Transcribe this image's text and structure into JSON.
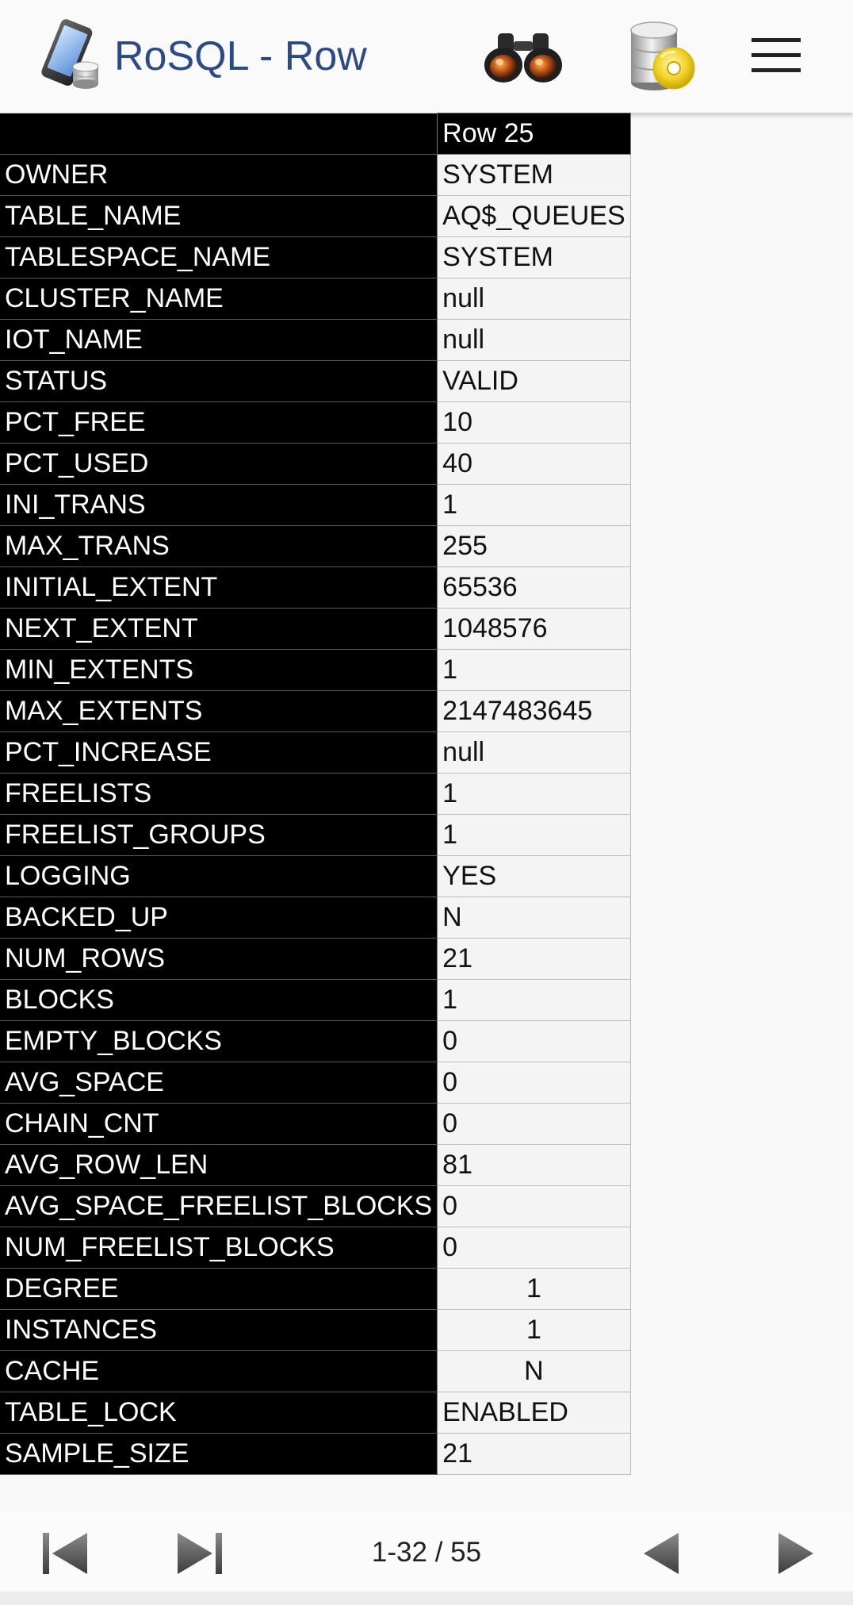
{
  "header": {
    "title": "RoSQL - Row",
    "icons": [
      "app-logo-icon",
      "binoculars-icon",
      "database-disc-icon",
      "hamburger-menu-icon"
    ]
  },
  "table": {
    "column_header": "Row 25",
    "rows": [
      {
        "key": "OWNER",
        "value": "SYSTEM",
        "align": "left"
      },
      {
        "key": "TABLE_NAME",
        "value": "AQ$_QUEUES",
        "align": "left"
      },
      {
        "key": "TABLESPACE_NAME",
        "value": "SYSTEM",
        "align": "left"
      },
      {
        "key": "CLUSTER_NAME",
        "value": "null",
        "align": "left"
      },
      {
        "key": "IOT_NAME",
        "value": "null",
        "align": "left"
      },
      {
        "key": "STATUS",
        "value": "VALID",
        "align": "left"
      },
      {
        "key": "PCT_FREE",
        "value": "10",
        "align": "left"
      },
      {
        "key": "PCT_USED",
        "value": "40",
        "align": "left"
      },
      {
        "key": "INI_TRANS",
        "value": "1",
        "align": "left"
      },
      {
        "key": "MAX_TRANS",
        "value": "255",
        "align": "left"
      },
      {
        "key": "INITIAL_EXTENT",
        "value": "65536",
        "align": "left"
      },
      {
        "key": "NEXT_EXTENT",
        "value": "1048576",
        "align": "left"
      },
      {
        "key": "MIN_EXTENTS",
        "value": "1",
        "align": "left"
      },
      {
        "key": "MAX_EXTENTS",
        "value": "2147483645",
        "align": "left"
      },
      {
        "key": "PCT_INCREASE",
        "value": "null",
        "align": "left"
      },
      {
        "key": "FREELISTS",
        "value": "1",
        "align": "left"
      },
      {
        "key": "FREELIST_GROUPS",
        "value": "1",
        "align": "left"
      },
      {
        "key": "LOGGING",
        "value": "YES",
        "align": "left"
      },
      {
        "key": "BACKED_UP",
        "value": "N",
        "align": "left"
      },
      {
        "key": "NUM_ROWS",
        "value": "21",
        "align": "left"
      },
      {
        "key": "BLOCKS",
        "value": "1",
        "align": "left"
      },
      {
        "key": "EMPTY_BLOCKS",
        "value": "0",
        "align": "left"
      },
      {
        "key": "AVG_SPACE",
        "value": "0",
        "align": "left"
      },
      {
        "key": "CHAIN_CNT",
        "value": "0",
        "align": "left"
      },
      {
        "key": "AVG_ROW_LEN",
        "value": "81",
        "align": "left"
      },
      {
        "key": "AVG_SPACE_FREELIST_BLOCKS",
        "value": "0",
        "align": "left"
      },
      {
        "key": "NUM_FREELIST_BLOCKS",
        "value": "0",
        "align": "left"
      },
      {
        "key": "DEGREE",
        "value": "1",
        "align": "center"
      },
      {
        "key": "INSTANCES",
        "value": "1",
        "align": "center"
      },
      {
        "key": "CACHE",
        "value": "N",
        "align": "center"
      },
      {
        "key": "TABLE_LOCK",
        "value": "ENABLED",
        "align": "left"
      },
      {
        "key": "SAMPLE_SIZE",
        "value": "21",
        "align": "left"
      }
    ]
  },
  "footer": {
    "page_info": "1-32 / 55",
    "icons": [
      "first-page-icon",
      "last-page-icon",
      "previous-icon",
      "next-icon"
    ]
  },
  "colors": {
    "title": "#2b4a86",
    "key_cell_bg": "#000000",
    "value_cell_bg": "#f4f4f4",
    "nav_arrow": "#555555"
  }
}
